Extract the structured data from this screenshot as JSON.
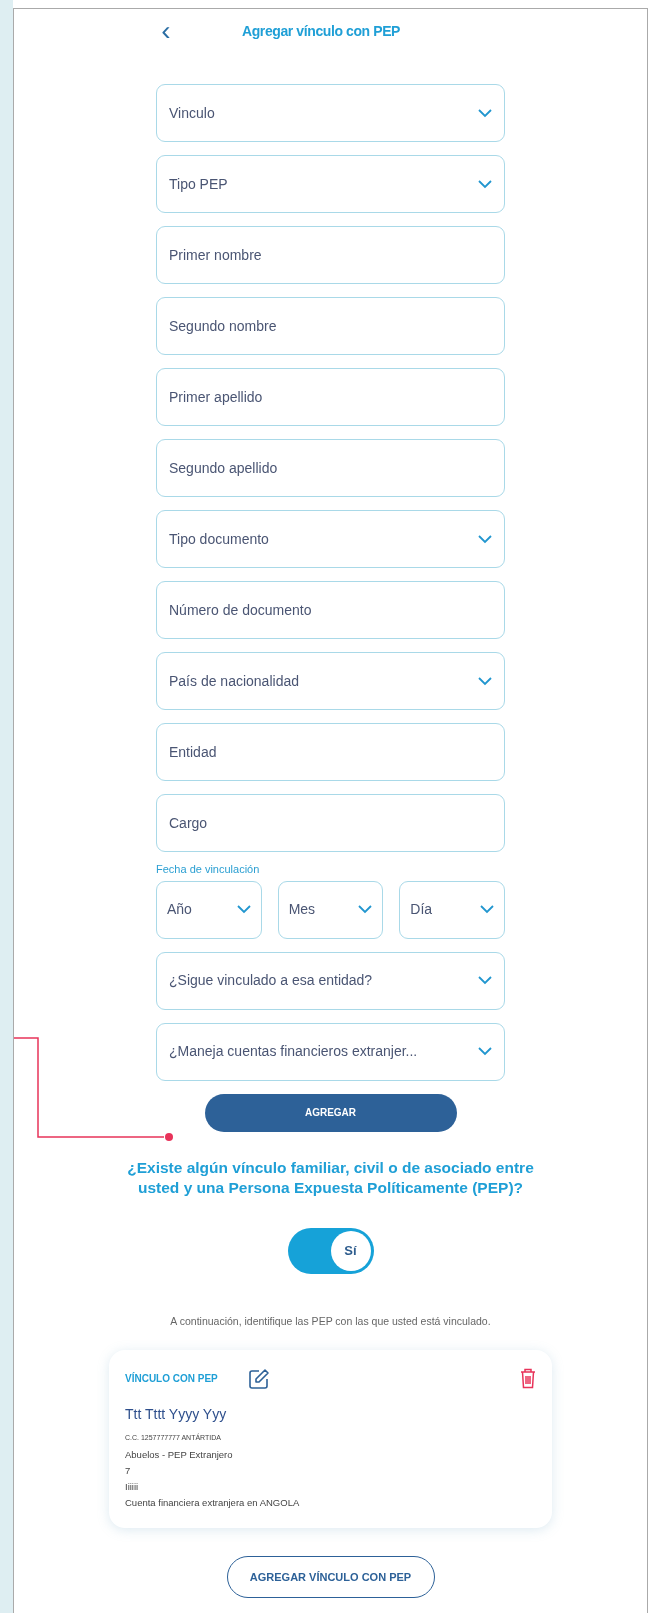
{
  "header": {
    "back": "‹",
    "title": "Agregar vínculo con PEP"
  },
  "fields": [
    {
      "kind": "select",
      "placeholder": "Vinculo"
    },
    {
      "kind": "select",
      "placeholder": "Tipo PEP"
    },
    {
      "kind": "text",
      "placeholder": "Primer nombre"
    },
    {
      "kind": "text",
      "placeholder": "Segundo nombre"
    },
    {
      "kind": "text",
      "placeholder": "Primer apellido"
    },
    {
      "kind": "text",
      "placeholder": "Segundo apellido"
    },
    {
      "kind": "select",
      "placeholder": "Tipo documento"
    },
    {
      "kind": "text",
      "placeholder": "Número de documento"
    },
    {
      "kind": "select",
      "placeholder": "País de nacionalidad"
    },
    {
      "kind": "text",
      "placeholder": "Entidad"
    },
    {
      "kind": "text",
      "placeholder": "Cargo"
    }
  ],
  "date": {
    "label": "Fecha de vinculación",
    "parts": [
      {
        "kind": "select",
        "placeholder": "Año"
      },
      {
        "kind": "select",
        "placeholder": "Mes"
      },
      {
        "kind": "select",
        "placeholder": "Día"
      }
    ]
  },
  "more_fields": [
    {
      "kind": "select",
      "placeholder": "¿Sigue vinculado a esa entidad?"
    },
    {
      "kind": "select",
      "placeholder": "¿Maneja cuentas financieros extranjer..."
    }
  ],
  "add_button": "AGREGAR",
  "question": "¿Existe algún vínculo familiar, civil o de asociado entre usted y una Persona Expuesta Políticamente (PEP)?",
  "toggle": {
    "on": true,
    "label": "Sí"
  },
  "info": "A continuación, identifique las PEP con las que usted está vinculado.",
  "card": {
    "title": "VÍNCULO CON PEP",
    "name": "Ttt Tttt Yyyy Yyy",
    "document": "C.C. 1257777777 ANTÁRTIDA",
    "lines": [
      "Abuelos - PEP Extranjero",
      "7",
      "Iiiiii",
      "Cuenta financiera extranjera en ANGOLA"
    ]
  },
  "bottom_button": "AGREGAR VÍNCULO CON PEP"
}
